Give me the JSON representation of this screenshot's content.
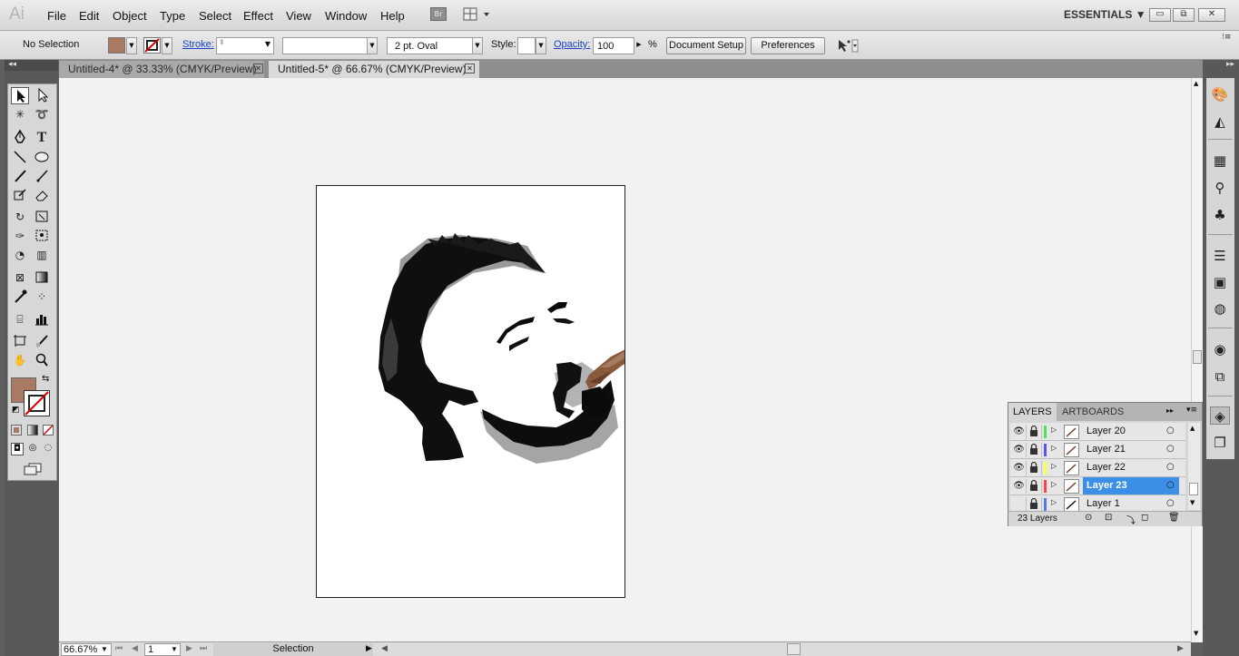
{
  "app": {
    "logo": "Ai",
    "workspace": "ESSENTIALS",
    "bridge_label": "Br"
  },
  "menu": [
    "File",
    "Edit",
    "Object",
    "Type",
    "Select",
    "Effect",
    "View",
    "Window",
    "Help"
  ],
  "window_controls": {
    "minimize": "▭",
    "restore": "⧉",
    "close": "✕"
  },
  "control_bar": {
    "selection": "No Selection",
    "stroke_label": "Stroke:",
    "brush": "2 pt. Oval",
    "style_label": "Style:",
    "opacity_label": "Opacity:",
    "opacity_value": "100",
    "opacity_unit": "%",
    "document_setup": "Document Setup",
    "preferences": "Preferences",
    "fill_color": "#a87a62"
  },
  "tabs": [
    {
      "label": "Untitled-4* @ 33.33% (CMYK/Preview)",
      "active": false
    },
    {
      "label": "Untitled-5* @ 66.67% (CMYK/Preview)",
      "active": true
    }
  ],
  "tools": [
    "selection-arrow",
    "direct-selection",
    "magic-wand",
    "lasso",
    "pen",
    "type",
    "line-segment",
    "ellipse",
    "paintbrush",
    "pencil",
    "blob-brush",
    "eraser",
    "rotate",
    "scale",
    "warp",
    "free-transform",
    "shape-builder",
    "perspective-grid",
    "mesh",
    "gradient",
    "eyedropper",
    "blend",
    "symbol-sprayer",
    "column-graph",
    "artboard",
    "slice",
    "hand",
    "zoom"
  ],
  "layers_panel": {
    "tabs": [
      "LAYERS",
      "ARTBOARDS"
    ],
    "layers": [
      {
        "name": "Layer 20",
        "color": "#55dd55",
        "visible": true,
        "selected": false
      },
      {
        "name": "Layer 21",
        "color": "#5555ff",
        "visible": true,
        "selected": false
      },
      {
        "name": "Layer 22",
        "color": "#ffff44",
        "visible": true,
        "selected": false
      },
      {
        "name": "Layer 23",
        "color": "#ff4444",
        "visible": true,
        "selected": true
      },
      {
        "name": "Layer 1",
        "color": "#5577ee",
        "visible": false,
        "selected": false
      }
    ],
    "count": "23 Layers"
  },
  "status": {
    "zoom": "66.67%",
    "artboard": "1",
    "tool": "Selection"
  },
  "colors": {
    "accent": "#3b8fe6",
    "artboard_bg": "#ffffff",
    "canvas_bg": "#f2f2f2"
  }
}
